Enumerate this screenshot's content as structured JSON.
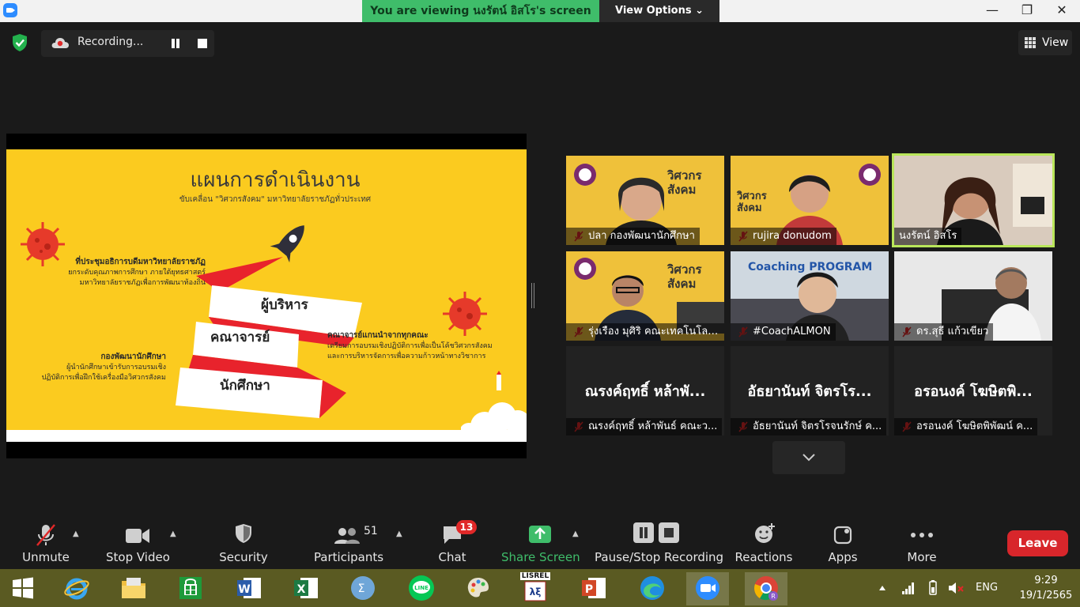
{
  "titlebar": {
    "banner": "You are viewing นงรัตน์ อิสโร's screen",
    "view_options": "View Options ⌄",
    "minimize": "—",
    "maximize": "❐",
    "close": "✕"
  },
  "topbar": {
    "recording_label": "Recording...",
    "view_label": "View"
  },
  "slide": {
    "title": "แผนการดำเนินงาน",
    "subtitle": "ขับเคลื่อน \"วิศวกรสังคม\" มหาวิทยาลัยราชภัฏทั่วประเทศ",
    "note1_head": "ที่ประชุมอธิการบดีมหาวิทยาลัยราชภัฏ",
    "note1_l1": "ยกระดับคุณภาพการศึกษา ภายใต้ยุทธศาสตร์",
    "note1_l2": "มหาวิทยาลัยราชภัฏเพื่อการพัฒนาท้องถิ่น",
    "note2_head": "กองพัฒนานักศึกษา",
    "note2_l1": "ผู้นำนักศึกษาเข้ารับการอบรมเชิง",
    "note2_l2": "ปฏิบัติการเพื่อฝึกใช้เครื่องมือวิศวกรสังคม",
    "note3_head": "คณาจารย์แกนนำจากทุกคณะ",
    "note3_l1": "เตรียมการอบรมเชิงปฏิบัติการเพื่อเป็นโค้ชวิศวกรสังคม",
    "note3_l2": "และการบริหารจัดการเพื่อความก้าวหน้าทางวิชาการ",
    "ribbon1": "ผู้บริหาร",
    "ribbon2": "คณาจารย์",
    "ribbon3": "นักศึกษา"
  },
  "gallery": {
    "tiles": [
      {
        "name": "ปลา กองพัฒนานักศึกษา"
      },
      {
        "name": "rujira donudom"
      },
      {
        "name": "นงรัตน์ อิสโร"
      },
      {
        "name": "รุ่งเรือง มุศิริ คณะเทคโนโลย..."
      },
      {
        "name": "#CoachALMON"
      },
      {
        "name": "ดร.สุธี แก้วเขียว"
      },
      {
        "name": "ณรงค์ฤทธิ์ หล้าพันธ์ คณะว...",
        "big": "ณรงค์ฤทธิ์ หล้าพั..."
      },
      {
        "name": "อัธยานันท์ จิตรโรจนรักษ์ ค...",
        "big": "อัธยานันท์ จิตรโร..."
      },
      {
        "name": "อรอนงค์ โฆษิตพิพัฒน์ ค...",
        "big": "อรอนงค์ โฆษิตพิ..."
      }
    ],
    "tile_texts": {
      "t1_logo": "วิศวกร สังคม",
      "t2_logo": "วิศวกร สังคม",
      "t4_logo": "วิศวกร สังคม",
      "t5_board": "Coaching PROGRAM"
    }
  },
  "toolbar": {
    "unmute": "Unmute",
    "stop_video": "Stop Video",
    "security": "Security",
    "participants": "Participants",
    "participants_count": "51",
    "chat": "Chat",
    "chat_badge": "13",
    "share_screen": "Share Screen",
    "pause_stop": "Pause/Stop Recording",
    "reactions": "Reactions",
    "apps": "Apps",
    "more": "More",
    "leave": "Leave"
  },
  "taskbar": {
    "lang": "ENG",
    "time": "9:29",
    "date": "19/1/2565",
    "lisrel": "LISREL"
  },
  "colors": {
    "share_green": "#3fbd6a",
    "leave_red": "#d8262b",
    "slide_yellow": "#fbcb1f",
    "active_speaker": "#b9e65a"
  }
}
